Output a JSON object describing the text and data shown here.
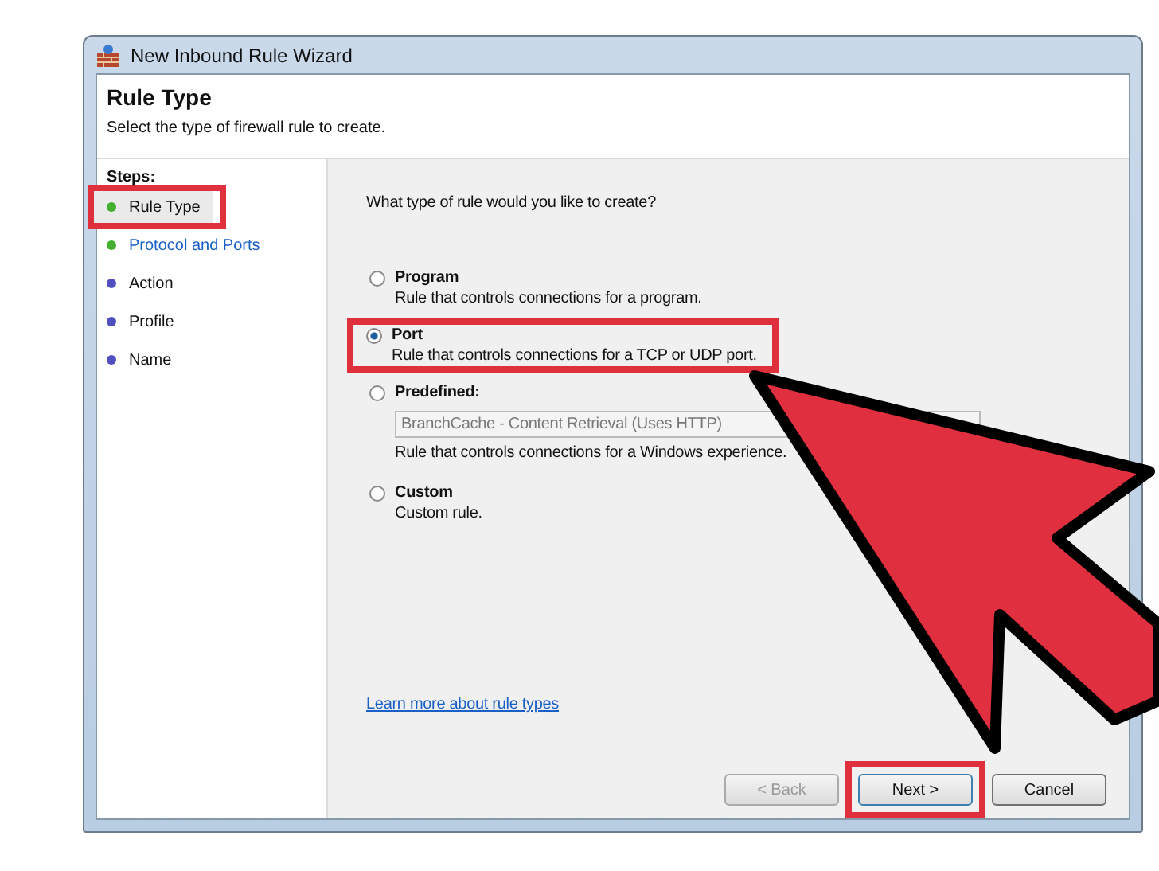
{
  "window": {
    "title": "New Inbound Rule Wizard"
  },
  "header": {
    "title": "Rule Type",
    "subtitle": "Select the type of firewall rule to create."
  },
  "steps_heading": "Steps:",
  "steps": [
    {
      "label": "Rule Type",
      "selected": true,
      "link": false,
      "highlighted": true,
      "color": "#44b030"
    },
    {
      "label": "Protocol and Ports",
      "selected": false,
      "link": true,
      "highlighted": false,
      "color": "#44b030"
    },
    {
      "label": "Action",
      "selected": false,
      "link": false,
      "highlighted": false,
      "color": "#5050c0"
    },
    {
      "label": "Profile",
      "selected": false,
      "link": false,
      "highlighted": false,
      "color": "#5050c0"
    },
    {
      "label": "Name",
      "selected": false,
      "link": false,
      "highlighted": false,
      "color": "#5050c0"
    }
  ],
  "question": "What type of rule would you like to create?",
  "options": [
    {
      "label": "Program",
      "description": "Rule that controls connections for a program.",
      "selected": false,
      "highlighted": false
    },
    {
      "label": "Port",
      "description": "Rule that controls connections for a TCP or UDP port.",
      "selected": true,
      "highlighted": true
    },
    {
      "label": "Predefined:",
      "dropdown": {
        "value": "BranchCache - Content Retrieval (Uses HTTP)",
        "disabled": true
      },
      "description": "Rule that controls connections for a Windows experience.",
      "selected": false,
      "highlighted": false
    },
    {
      "label": "Custom",
      "description": "Custom rule.",
      "selected": false,
      "highlighted": false
    }
  ],
  "help_link": "Learn more about rule types",
  "buttons": [
    {
      "label": "< Back",
      "disabled": true,
      "default": false,
      "highlighted": false
    },
    {
      "label": "Next >",
      "disabled": false,
      "default": true,
      "highlighted": true
    },
    {
      "label": "Cancel",
      "disabled": false,
      "default": false,
      "highlighted": false
    }
  ],
  "annotation_arrow": true
}
